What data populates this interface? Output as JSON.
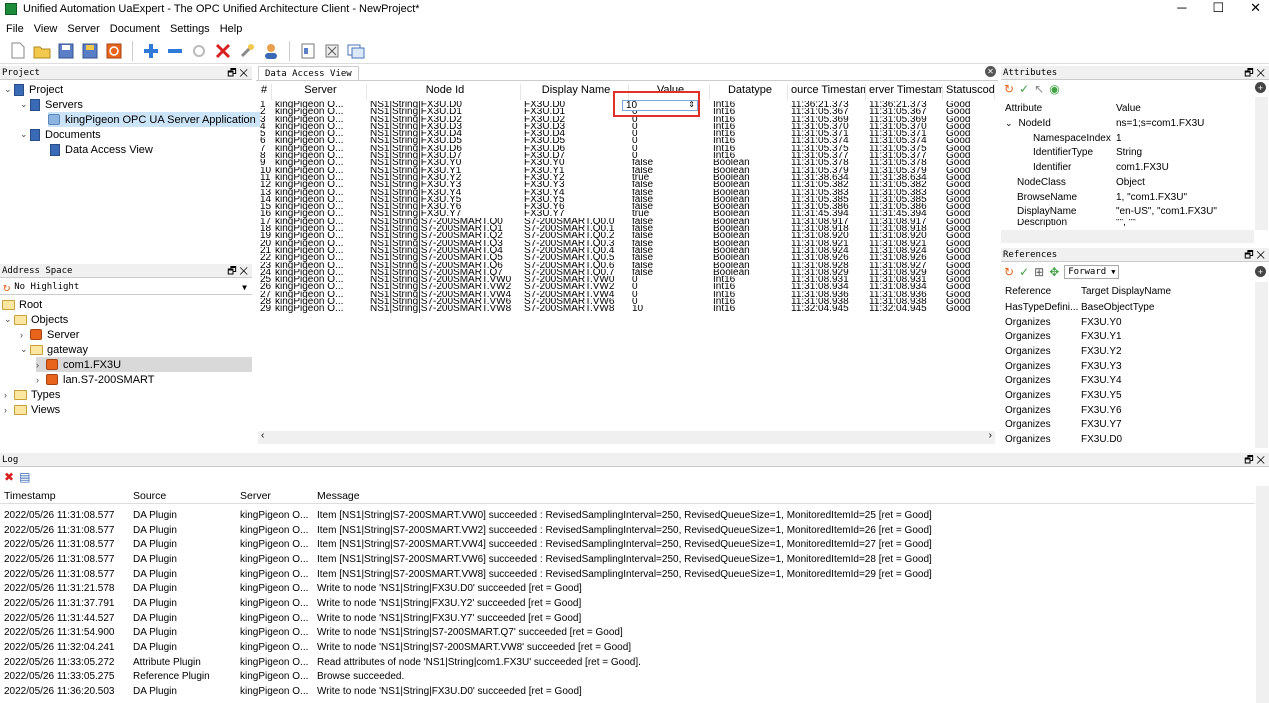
{
  "window": {
    "title": "Unified Automation UaExpert - The OPC Unified Architecture Client - NewProject*",
    "minimize": "─",
    "maximize": "☐",
    "close": "✕"
  },
  "menu": [
    "File",
    "View",
    "Server",
    "Document",
    "Settings",
    "Help"
  ],
  "toolbar_icons": [
    "new-file-icon",
    "open-folder-icon",
    "save-icon",
    "save-as-icon",
    "close-project-icon",
    "add-server-icon",
    "remove-server-icon",
    "connect-icon",
    "disconnect-icon",
    "settings-icon",
    "user-icon",
    "report-icon",
    "cut-icon",
    "window-icon"
  ],
  "project_panel": {
    "title": "Project",
    "items": [
      "Project",
      "Servers",
      "kingPigeon OPC UA Server Application",
      "Documents",
      "Data Access View"
    ]
  },
  "address_space": {
    "title": "Address Space",
    "highlight": "No Highlight",
    "items": [
      "Root",
      "Objects",
      "Server",
      "gateway",
      "com1.FX3U",
      "lan.S7-200SMART",
      "Types",
      "Views"
    ]
  },
  "dav": {
    "tab": "Data Access View",
    "columns": [
      "#",
      "Server",
      "Node Id",
      "Display Name",
      "Value",
      "Datatype",
      "ource Timestam",
      "erver Timestam",
      "Statuscode"
    ],
    "value_input": "10",
    "rows": [
      [
        "1",
        "kingPigeon O...",
        "NS1|String|FX3U.D0",
        "FX3U.D0",
        "10",
        "Int16",
        "11:36:21.373",
        "11:36:21.373",
        "Good"
      ],
      [
        "2",
        "kingPigeon O...",
        "NS1|String|FX3U.D1",
        "FX3U.D1",
        "0",
        "Int16",
        "11:31:05.367",
        "11:31:05.367",
        "Good"
      ],
      [
        "3",
        "kingPigeon O...",
        "NS1|String|FX3U.D2",
        "FX3U.D2",
        "0",
        "Int16",
        "11:31:05.369",
        "11:31:05.369",
        "Good"
      ],
      [
        "4",
        "kingPigeon O...",
        "NS1|String|FX3U.D3",
        "FX3U.D3",
        "0",
        "Int16",
        "11:31:05.370",
        "11:31:05.370",
        "Good"
      ],
      [
        "5",
        "kingPigeon O...",
        "NS1|String|FX3U.D4",
        "FX3U.D4",
        "0",
        "Int16",
        "11:31:05.371",
        "11:31:05.371",
        "Good"
      ],
      [
        "6",
        "kingPigeon O...",
        "NS1|String|FX3U.D5",
        "FX3U.D5",
        "0",
        "Int16",
        "11:31:05.374",
        "11:31:05.374",
        "Good"
      ],
      [
        "7",
        "kingPigeon O...",
        "NS1|String|FX3U.D6",
        "FX3U.D6",
        "0",
        "Int16",
        "11:31:05.375",
        "11:31:05.375",
        "Good"
      ],
      [
        "8",
        "kingPigeon O...",
        "NS1|String|FX3U.D7",
        "FX3U.D7",
        "0",
        "Int16",
        "11:31:05.377",
        "11:31:05.377",
        "Good"
      ],
      [
        "9",
        "kingPigeon O...",
        "NS1|String|FX3U.Y0",
        "FX3U.Y0",
        "false",
        "Boolean",
        "11:31:05.378",
        "11:31:05.378",
        "Good"
      ],
      [
        "10",
        "kingPigeon O...",
        "NS1|String|FX3U.Y1",
        "FX3U.Y1",
        "false",
        "Boolean",
        "11:31:05.379",
        "11:31:05.379",
        "Good"
      ],
      [
        "11",
        "kingPigeon O...",
        "NS1|String|FX3U.Y2",
        "FX3U.Y2",
        "true",
        "Boolean",
        "11:31:38.634",
        "11:31:38.634",
        "Good"
      ],
      [
        "12",
        "kingPigeon O...",
        "NS1|String|FX3U.Y3",
        "FX3U.Y3",
        "false",
        "Boolean",
        "11:31:05.382",
        "11:31:05.382",
        "Good"
      ],
      [
        "13",
        "kingPigeon O...",
        "NS1|String|FX3U.Y4",
        "FX3U.Y4",
        "false",
        "Boolean",
        "11:31:05.383",
        "11:31:05.383",
        "Good"
      ],
      [
        "14",
        "kingPigeon O...",
        "NS1|String|FX3U.Y5",
        "FX3U.Y5",
        "false",
        "Boolean",
        "11:31:05.385",
        "11:31:05.385",
        "Good"
      ],
      [
        "15",
        "kingPigeon O...",
        "NS1|String|FX3U.Y6",
        "FX3U.Y6",
        "false",
        "Boolean",
        "11:31:05.386",
        "11:31:05.386",
        "Good"
      ],
      [
        "16",
        "kingPigeon O...",
        "NS1|String|FX3U.Y7",
        "FX3U.Y7",
        "true",
        "Boolean",
        "11:31:45.394",
        "11:31:45.394",
        "Good"
      ],
      [
        "17",
        "kingPigeon O...",
        "NS1|String|S7-200SMART.Q0",
        "S7-200SMART.Q0.0",
        "false",
        "Boolean",
        "11:31:08.917",
        "11:31:08.917",
        "Good"
      ],
      [
        "18",
        "kingPigeon O...",
        "NS1|String|S7-200SMART.Q1",
        "S7-200SMART.Q0.1",
        "false",
        "Boolean",
        "11:31:08.918",
        "11:31:08.918",
        "Good"
      ],
      [
        "19",
        "kingPigeon O...",
        "NS1|String|S7-200SMART.Q2",
        "S7-200SMART.Q0.2",
        "false",
        "Boolean",
        "11:31:08.920",
        "11:31:08.920",
        "Good"
      ],
      [
        "20",
        "kingPigeon O...",
        "NS1|String|S7-200SMART.Q3",
        "S7-200SMART.Q0.3",
        "false",
        "Boolean",
        "11:31:08.921",
        "11:31:08.921",
        "Good"
      ],
      [
        "21",
        "kingPigeon O...",
        "NS1|String|S7-200SMART.Q4",
        "S7-200SMART.Q0.4",
        "false",
        "Boolean",
        "11:31:08.924",
        "11:31:08.924",
        "Good"
      ],
      [
        "22",
        "kingPigeon O...",
        "NS1|String|S7-200SMART.Q5",
        "S7-200SMART.Q0.5",
        "false",
        "Boolean",
        "11:31:08.926",
        "11:31:08.926",
        "Good"
      ],
      [
        "23",
        "kingPigeon O...",
        "NS1|String|S7-200SMART.Q6",
        "S7-200SMART.Q0.6",
        "false",
        "Boolean",
        "11:31:08.928",
        "11:31:08.927",
        "Good"
      ],
      [
        "24",
        "kingPigeon O...",
        "NS1|String|S7-200SMART.Q7",
        "S7-200SMART.Q0.7",
        "false",
        "Boolean",
        "11:31:08.929",
        "11:31:08.929",
        "Good"
      ],
      [
        "25",
        "kingPigeon O...",
        "NS1|String|S7-200SMART.VW0",
        "S7-200SMART.VW0",
        "0",
        "Int16",
        "11:31:08.931",
        "11:31:08.931",
        "Good"
      ],
      [
        "26",
        "kingPigeon O...",
        "NS1|String|S7-200SMART.VW2",
        "S7-200SMART.VW2",
        "0",
        "Int16",
        "11:31:08.934",
        "11:31:08.934",
        "Good"
      ],
      [
        "27",
        "kingPigeon O...",
        "NS1|String|S7-200SMART.VW4",
        "S7-200SMART.VW4",
        "0",
        "Int16",
        "11:31:08.936",
        "11:31:08.936",
        "Good"
      ],
      [
        "28",
        "kingPigeon O...",
        "NS1|String|S7-200SMART.VW6",
        "S7-200SMART.VW6",
        "0",
        "Int16",
        "11:31:08.938",
        "11:31:08.938",
        "Good"
      ],
      [
        "29",
        "kingPigeon O...",
        "NS1|String|S7-200SMART.VW8",
        "S7-200SMART.VW8",
        "10",
        "Int16",
        "11:32:04.945",
        "11:32:04.945",
        "Good"
      ]
    ]
  },
  "attributes": {
    "title": "Attributes",
    "columns": [
      "Attribute",
      "Value"
    ],
    "rows": [
      [
        "NodeId",
        "ns=1;s=com1.FX3U"
      ],
      [
        "NamespaceIndex",
        "1"
      ],
      [
        "IdentifierType",
        "String"
      ],
      [
        "Identifier",
        "com1.FX3U"
      ],
      [
        "NodeClass",
        "Object"
      ],
      [
        "BrowseName",
        "1, \"com1.FX3U\""
      ],
      [
        "DisplayName",
        "\"en-US\", \"com1.FX3U\""
      ],
      [
        "Description",
        "\"\", \"\""
      ]
    ]
  },
  "references": {
    "title": "References",
    "direction": "Forward",
    "columns": [
      "Reference",
      "Target DisplayName"
    ],
    "rows": [
      [
        "HasTypeDefini...",
        "BaseObjectType"
      ],
      [
        "Organizes",
        "FX3U.Y0"
      ],
      [
        "Organizes",
        "FX3U.Y1"
      ],
      [
        "Organizes",
        "FX3U.Y2"
      ],
      [
        "Organizes",
        "FX3U.Y3"
      ],
      [
        "Organizes",
        "FX3U.Y4"
      ],
      [
        "Organizes",
        "FX3U.Y5"
      ],
      [
        "Organizes",
        "FX3U.Y6"
      ],
      [
        "Organizes",
        "FX3U.Y7"
      ],
      [
        "Organizes",
        "FX3U.D0"
      ]
    ]
  },
  "log": {
    "title": "Log",
    "columns": [
      "Timestamp",
      "Source",
      "Server",
      "Message"
    ],
    "rows": [
      [
        "2022/05/26 11:31:08.577",
        "DA Plugin",
        "kingPigeon O...",
        "Item [NS1|String|S7-200SMART.VW0] succeeded : RevisedSamplingInterval=250, RevisedQueueSize=1, MonitoredItemId=25 [ret = Good]"
      ],
      [
        "2022/05/26 11:31:08.577",
        "DA Plugin",
        "kingPigeon O...",
        "Item [NS1|String|S7-200SMART.VW2] succeeded : RevisedSamplingInterval=250, RevisedQueueSize=1, MonitoredItemId=26 [ret = Good]"
      ],
      [
        "2022/05/26 11:31:08.577",
        "DA Plugin",
        "kingPigeon O...",
        "Item [NS1|String|S7-200SMART.VW4] succeeded : RevisedSamplingInterval=250, RevisedQueueSize=1, MonitoredItemId=27 [ret = Good]"
      ],
      [
        "2022/05/26 11:31:08.577",
        "DA Plugin",
        "kingPigeon O...",
        "Item [NS1|String|S7-200SMART.VW6] succeeded : RevisedSamplingInterval=250, RevisedQueueSize=1, MonitoredItemId=28 [ret = Good]"
      ],
      [
        "2022/05/26 11:31:08.577",
        "DA Plugin",
        "kingPigeon O...",
        "Item [NS1|String|S7-200SMART.VW8] succeeded : RevisedSamplingInterval=250, RevisedQueueSize=1, MonitoredItemId=29 [ret = Good]"
      ],
      [
        "2022/05/26 11:31:21.578",
        "DA Plugin",
        "kingPigeon O...",
        "Write to node 'NS1|String|FX3U.D0' succeeded [ret = Good]"
      ],
      [
        "2022/05/26 11:31:37.791",
        "DA Plugin",
        "kingPigeon O...",
        "Write to node 'NS1|String|FX3U.Y2' succeeded [ret = Good]"
      ],
      [
        "2022/05/26 11:31:44.527",
        "DA Plugin",
        "kingPigeon O...",
        "Write to node 'NS1|String|FX3U.Y7' succeeded [ret = Good]"
      ],
      [
        "2022/05/26 11:31:54.900",
        "DA Plugin",
        "kingPigeon O...",
        "Write to node 'NS1|String|S7-200SMART.Q7' succeeded [ret = Good]"
      ],
      [
        "2022/05/26 11:32:04.241",
        "DA Plugin",
        "kingPigeon O...",
        "Write to node 'NS1|String|S7-200SMART.VW8' succeeded [ret = Good]"
      ],
      [
        "2022/05/26 11:33:05.272",
        "Attribute Plugin",
        "kingPigeon O...",
        "Read attributes of node 'NS1|String|com1.FX3U' succeeded [ret = Good]."
      ],
      [
        "2022/05/26 11:33:05.275",
        "Reference Plugin",
        "kingPigeon O...",
        "Browse succeeded."
      ],
      [
        "2022/05/26 11:36:20.503",
        "DA Plugin",
        "kingPigeon O...",
        "Write to node 'NS1|String|FX3U.D0' succeeded [ret = Good]"
      ]
    ]
  },
  "colors": {
    "highlight_box": "#e0302a",
    "selection": "#cce4f7",
    "accent_orange": "#e8641c",
    "accent_green": "#3fa344"
  }
}
